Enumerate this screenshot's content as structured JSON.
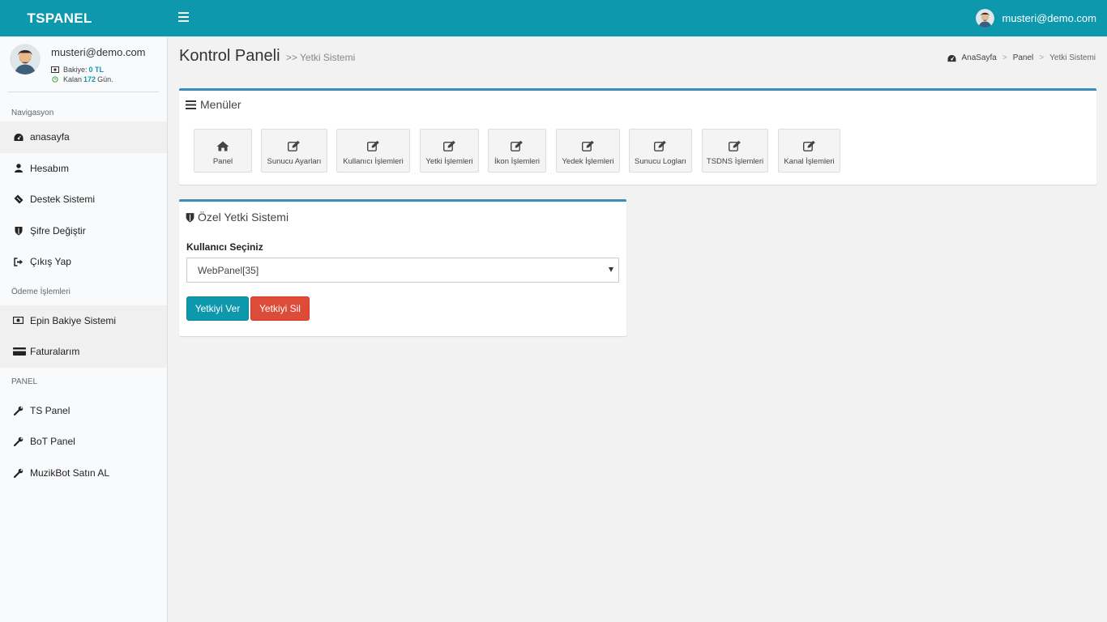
{
  "header": {
    "logo": "TSPANEL",
    "user_email": "musteri@demo.com",
    "colors": {
      "topbar": "#0e98ad"
    }
  },
  "sidebar": {
    "user": {
      "email": "musteri@demo.com",
      "balance_label": "Bakiye:",
      "balance_value": "0 TL",
      "remaining_label": "Kalan",
      "remaining_value": "172",
      "remaining_unit": "Gün."
    },
    "sections": [
      {
        "header": "Navigasyon"
      },
      {
        "header": "Ödeme İşlemleri"
      },
      {
        "header": "PANEL"
      }
    ],
    "items": [
      {
        "label": "anasayfa",
        "icon": "dashboard-icon"
      },
      {
        "label": "Hesabım",
        "icon": "user-icon"
      },
      {
        "label": "Destek Sistemi",
        "icon": "ticket-icon"
      },
      {
        "label": "Şifre Değiştir",
        "icon": "shield-icon"
      },
      {
        "label": "Çıkış Yap",
        "icon": "sign-out-icon"
      },
      {
        "label": "Epin Bakiye Sistemi",
        "icon": "money-icon"
      },
      {
        "label": "Faturalarım",
        "icon": "credit-card-icon"
      },
      {
        "label": "TS Panel",
        "icon": "wrench-icon"
      },
      {
        "label": "BoT Panel",
        "icon": "wrench-icon"
      },
      {
        "label": "MuzikBot Satın AL",
        "icon": "wrench-icon"
      }
    ]
  },
  "content": {
    "title": "Kontrol Paneli",
    "subtitle": ">> Yetki Sistemi",
    "breadcrumb": [
      "AnaSayfa",
      "Panel",
      "Yetki Sistemi"
    ]
  },
  "menus_box": {
    "title": "Menüler",
    "buttons": [
      {
        "label": "Panel",
        "icon": "home-icon"
      },
      {
        "label": "Sunucu Ayarları",
        "icon": "edit-icon"
      },
      {
        "label": "Kullanıcı İşlemleri",
        "icon": "edit-icon"
      },
      {
        "label": "Yetki İşlemleri",
        "icon": "edit-icon"
      },
      {
        "label": "İkon İşlemleri",
        "icon": "edit-icon"
      },
      {
        "label": "Yedek İşlemleri",
        "icon": "edit-icon"
      },
      {
        "label": "Sunucu Logları",
        "icon": "edit-icon"
      },
      {
        "label": "TSDNS İşlemleri",
        "icon": "edit-icon"
      },
      {
        "label": "Kanal İşlemleri",
        "icon": "edit-icon"
      }
    ]
  },
  "perm_box": {
    "title": "Özel Yetki Sistemi",
    "select_label": "Kullanıcı Seçiniz",
    "select_value": "WebPanel[35]",
    "grant_button": "Yetkiyi Ver",
    "revoke_button": "Yetkiyi Sil",
    "colors": {
      "grant": "#0e98ad",
      "revoke": "#dd4b39"
    }
  }
}
